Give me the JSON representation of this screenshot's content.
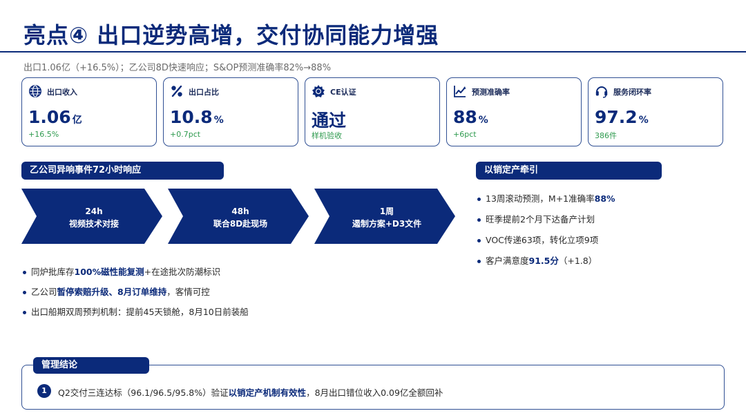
{
  "page": {
    "title": "亮点④ 出口逆势高增，交付协同能力增强",
    "subtitle": "出口1.06亿（+16.5%）；乙公司8D快速响应；S&OP预测准确率82%→88%"
  },
  "kpis": [
    {
      "label": "出口收入",
      "value": "1.06",
      "unit": "亿",
      "delta": "+16.5%",
      "icon": "globe-icon"
    },
    {
      "label": "出口占比",
      "value": "10.8",
      "unit": "%",
      "delta": "+0.7pct",
      "icon": "percent-icon"
    },
    {
      "label": "CE认证",
      "value": "通过",
      "unit": "",
      "delta": "样机验收",
      "icon": "certificate-badge-icon"
    },
    {
      "label": "预测准确率",
      "value": "88",
      "unit": "%",
      "delta": "+6pct",
      "icon": "trend-chart-icon"
    },
    {
      "label": "服务闭环率",
      "value": "97.2",
      "unit": "%",
      "delta": "386件",
      "icon": "headset-icon"
    }
  ],
  "left_section": {
    "header": "乙公司异响事件72小时响应",
    "steps": [
      {
        "time": "24h",
        "desc": "视频技术对接"
      },
      {
        "time": "48h",
        "desc": "联合8D赴现场"
      },
      {
        "time": "1周",
        "desc": "遏制方案+D3文件"
      }
    ],
    "bullets": [
      {
        "pre": "同炉批库存",
        "hl": "100%磁性能复测",
        "post": "+在途批次防潮标识"
      },
      {
        "pre": "乙公司",
        "hl": "暂停索赔升级、8月订单维持",
        "post": "，客情可控"
      },
      {
        "pre": "出口船期双周预判机制：提前45天锁舱，8月10日前装船",
        "hl": "",
        "post": ""
      }
    ]
  },
  "right_section": {
    "header": "以销定产牵引",
    "bullets": [
      {
        "pre": "13周滚动预测，M+1准确率",
        "hl": "88%",
        "post": ""
      },
      {
        "pre": "旺季提前2个月下达备产计划",
        "hl": "",
        "post": ""
      },
      {
        "pre": "VOC传递63项，转化立项9项",
        "hl": "",
        "post": ""
      },
      {
        "pre": "客户满意度",
        "hl": "91.5分",
        "post": "（+1.8）"
      }
    ]
  },
  "conclusion": {
    "header": "管理结论",
    "number": "1",
    "pre": "Q2交付三连达标（96.1/96.5/95.8%）验证",
    "hl": "以销定产机制有效性",
    "post": "，8月出口错位收入0.09亿全额回补"
  },
  "colors": {
    "primary": "#0b2a7a",
    "border": "#2f4f93",
    "positive": "#2e9a4e"
  }
}
